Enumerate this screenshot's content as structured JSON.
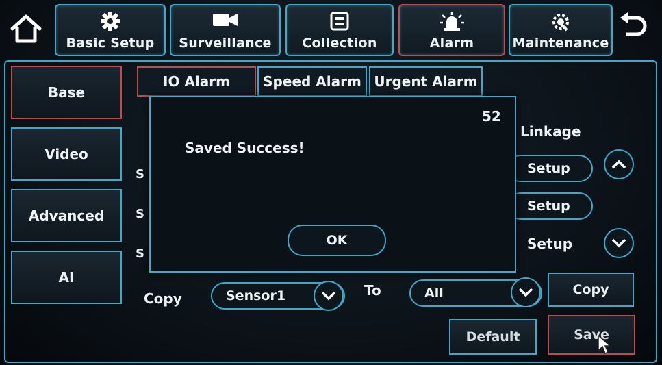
{
  "top_tabs": [
    {
      "label": "Basic Setup",
      "icon": "gear-icon"
    },
    {
      "label": "Surveillance",
      "icon": "camera-icon"
    },
    {
      "label": "Collection",
      "icon": "storage-icon"
    },
    {
      "label": "Alarm",
      "icon": "siren-icon"
    },
    {
      "label": "Maintenance",
      "icon": "wrench-gear-icon"
    }
  ],
  "sidebar": [
    {
      "label": "Base"
    },
    {
      "label": "Video"
    },
    {
      "label": "Advanced"
    },
    {
      "label": "AI"
    }
  ],
  "subtabs": [
    {
      "label": "IO Alarm"
    },
    {
      "label": "Speed Alarm"
    },
    {
      "label": "Urgent Alarm"
    }
  ],
  "linkage": {
    "header": "Linkage",
    "setup_labels": [
      "Setup",
      "Setup",
      "Setup"
    ]
  },
  "copy": {
    "label": "Copy",
    "source_value": "Sensor1",
    "to_label": "To",
    "target_value": "All",
    "button": "Copy"
  },
  "footer": {
    "default_label": "Default",
    "save_label": "Save"
  },
  "dialog": {
    "countdown": "52",
    "message": "Saved Success!",
    "ok_label": "OK"
  },
  "colors": {
    "accent": "#3fa9c9",
    "active": "#c24a4a",
    "background": "#0b1118"
  }
}
